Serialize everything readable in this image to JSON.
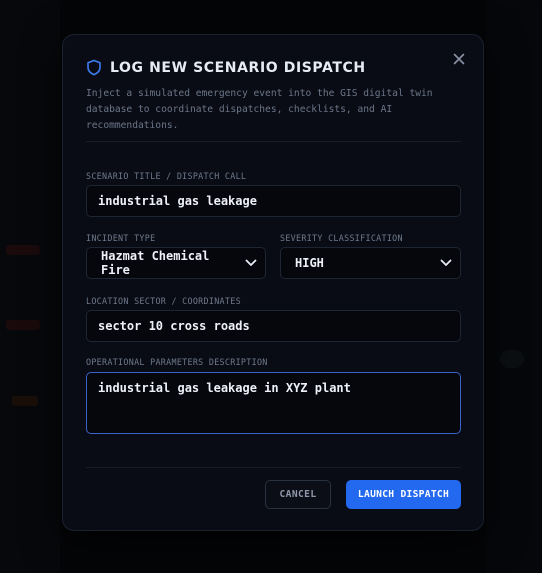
{
  "colors": {
    "accent": "#2269f0",
    "modal_bg": "#090c14",
    "field_bg": "#05070c",
    "focus_border": "#3b63c9",
    "shield_icon": "#3d7cf2"
  },
  "dialog": {
    "title": "LOG NEW SCENARIO DISPATCH",
    "description": "Inject a simulated emergency event into the GIS digital twin database to coordinate dispatches, checklists, and AI recommendations.",
    "header_icon": "shield-icon",
    "close_icon": "close-icon"
  },
  "form": {
    "scenario_title": {
      "label": "SCENARIO TITLE / DISPATCH CALL",
      "value": "industrial gas leakage"
    },
    "incident_type": {
      "label": "INCIDENT TYPE",
      "selected": "Hazmat Chemical Fire"
    },
    "severity": {
      "label": "SEVERITY CLASSIFICATION",
      "selected": "HIGH"
    },
    "location": {
      "label": "LOCATION SECTOR / COORDINATES",
      "value": "sector 10 cross roads"
    },
    "parameters": {
      "label": "OPERATIONAL PARAMETERS DESCRIPTION",
      "value": "industrial gas leakage in XYZ plant"
    }
  },
  "actions": {
    "cancel_label": "CANCEL",
    "launch_label": "LAUNCH DISPATCH"
  }
}
